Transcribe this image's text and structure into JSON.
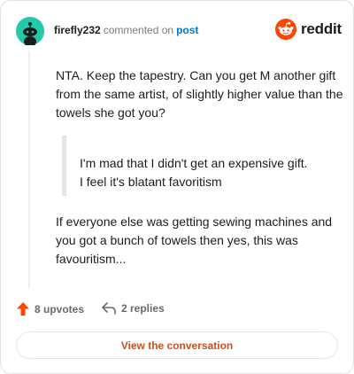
{
  "header": {
    "username": "firefly232",
    "action": "commented on",
    "post_link": "post",
    "brand_name": "reddit",
    "brand_color": "#ff4500",
    "avatar_icon": "snoo-avatar-icon",
    "avatar_color": "#24c9a9"
  },
  "comment": {
    "paragraph_1": "NTA. Keep the tapestry. Can you get M another gift from the same artist, of slightly higher value than the towels she got you?",
    "quote_line_1": "I'm mad that I didn't get an expensive gift.",
    "quote_line_2": "I feel it's blatant favoritism",
    "paragraph_2": "If everyone else was getting sewing machines and you got a bunch of towels then yes, this was favouritism..."
  },
  "footer": {
    "upvotes": "8 upvotes",
    "replies": "2 replies",
    "upvote_icon": "upvote-arrow-icon",
    "reply_icon": "reply-icon",
    "upvote_color": "#ff4500",
    "view_button": "View the conversation",
    "view_button_color": "#c8501e"
  }
}
